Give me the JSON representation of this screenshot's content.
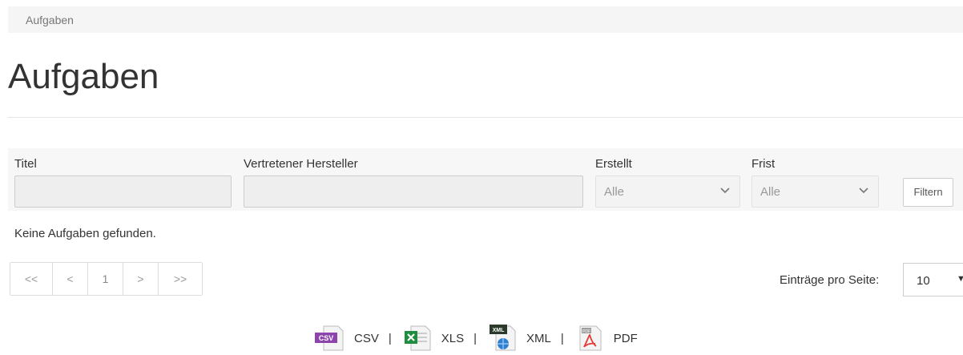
{
  "breadcrumb": {
    "item": "Aufgaben"
  },
  "page": {
    "title": "Aufgaben"
  },
  "filters": {
    "titel_label": "Titel",
    "titel_value": "",
    "hersteller_label": "Vertretener Hersteller",
    "hersteller_value": "",
    "erstellt_label": "Erstellt",
    "erstellt_value": "Alle",
    "frist_label": "Frist",
    "frist_value": "Alle",
    "filter_button": "Filtern"
  },
  "results": {
    "empty_message": "Keine Aufgaben gefunden."
  },
  "pagination": {
    "first": "<<",
    "prev": "<",
    "current": "1",
    "next": ">",
    "last": ">>",
    "per_page_label": "Einträge pro Seite:",
    "per_page_value": "10"
  },
  "exports": {
    "csv": "CSV",
    "xls": "XLS",
    "xml": "XML",
    "pdf": "PDF",
    "separator": "|",
    "csv_badge": "CSV",
    "xml_badge": "XML",
    "pdf_badge": "PDF"
  },
  "colors": {
    "csv_icon": "#8e44ad",
    "xls_icon": "#1e8e3e",
    "pdf_icon": "#e53935"
  }
}
